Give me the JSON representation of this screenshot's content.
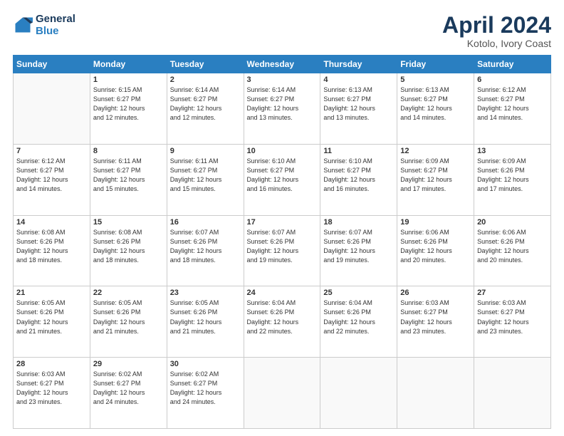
{
  "header": {
    "logo_line1": "General",
    "logo_line2": "Blue",
    "main_title": "April 2024",
    "subtitle": "Kotolo, Ivory Coast"
  },
  "calendar": {
    "days_of_week": [
      "Sunday",
      "Monday",
      "Tuesday",
      "Wednesday",
      "Thursday",
      "Friday",
      "Saturday"
    ],
    "weeks": [
      [
        {
          "day": "",
          "info": ""
        },
        {
          "day": "1",
          "info": "Sunrise: 6:15 AM\nSunset: 6:27 PM\nDaylight: 12 hours\nand 12 minutes."
        },
        {
          "day": "2",
          "info": "Sunrise: 6:14 AM\nSunset: 6:27 PM\nDaylight: 12 hours\nand 12 minutes."
        },
        {
          "day": "3",
          "info": "Sunrise: 6:14 AM\nSunset: 6:27 PM\nDaylight: 12 hours\nand 13 minutes."
        },
        {
          "day": "4",
          "info": "Sunrise: 6:13 AM\nSunset: 6:27 PM\nDaylight: 12 hours\nand 13 minutes."
        },
        {
          "day": "5",
          "info": "Sunrise: 6:13 AM\nSunset: 6:27 PM\nDaylight: 12 hours\nand 14 minutes."
        },
        {
          "day": "6",
          "info": "Sunrise: 6:12 AM\nSunset: 6:27 PM\nDaylight: 12 hours\nand 14 minutes."
        }
      ],
      [
        {
          "day": "7",
          "info": "Sunrise: 6:12 AM\nSunset: 6:27 PM\nDaylight: 12 hours\nand 14 minutes."
        },
        {
          "day": "8",
          "info": "Sunrise: 6:11 AM\nSunset: 6:27 PM\nDaylight: 12 hours\nand 15 minutes."
        },
        {
          "day": "9",
          "info": "Sunrise: 6:11 AM\nSunset: 6:27 PM\nDaylight: 12 hours\nand 15 minutes."
        },
        {
          "day": "10",
          "info": "Sunrise: 6:10 AM\nSunset: 6:27 PM\nDaylight: 12 hours\nand 16 minutes."
        },
        {
          "day": "11",
          "info": "Sunrise: 6:10 AM\nSunset: 6:27 PM\nDaylight: 12 hours\nand 16 minutes."
        },
        {
          "day": "12",
          "info": "Sunrise: 6:09 AM\nSunset: 6:27 PM\nDaylight: 12 hours\nand 17 minutes."
        },
        {
          "day": "13",
          "info": "Sunrise: 6:09 AM\nSunset: 6:26 PM\nDaylight: 12 hours\nand 17 minutes."
        }
      ],
      [
        {
          "day": "14",
          "info": "Sunrise: 6:08 AM\nSunset: 6:26 PM\nDaylight: 12 hours\nand 18 minutes."
        },
        {
          "day": "15",
          "info": "Sunrise: 6:08 AM\nSunset: 6:26 PM\nDaylight: 12 hours\nand 18 minutes."
        },
        {
          "day": "16",
          "info": "Sunrise: 6:07 AM\nSunset: 6:26 PM\nDaylight: 12 hours\nand 18 minutes."
        },
        {
          "day": "17",
          "info": "Sunrise: 6:07 AM\nSunset: 6:26 PM\nDaylight: 12 hours\nand 19 minutes."
        },
        {
          "day": "18",
          "info": "Sunrise: 6:07 AM\nSunset: 6:26 PM\nDaylight: 12 hours\nand 19 minutes."
        },
        {
          "day": "19",
          "info": "Sunrise: 6:06 AM\nSunset: 6:26 PM\nDaylight: 12 hours\nand 20 minutes."
        },
        {
          "day": "20",
          "info": "Sunrise: 6:06 AM\nSunset: 6:26 PM\nDaylight: 12 hours\nand 20 minutes."
        }
      ],
      [
        {
          "day": "21",
          "info": "Sunrise: 6:05 AM\nSunset: 6:26 PM\nDaylight: 12 hours\nand 21 minutes."
        },
        {
          "day": "22",
          "info": "Sunrise: 6:05 AM\nSunset: 6:26 PM\nDaylight: 12 hours\nand 21 minutes."
        },
        {
          "day": "23",
          "info": "Sunrise: 6:05 AM\nSunset: 6:26 PM\nDaylight: 12 hours\nand 21 minutes."
        },
        {
          "day": "24",
          "info": "Sunrise: 6:04 AM\nSunset: 6:26 PM\nDaylight: 12 hours\nand 22 minutes."
        },
        {
          "day": "25",
          "info": "Sunrise: 6:04 AM\nSunset: 6:26 PM\nDaylight: 12 hours\nand 22 minutes."
        },
        {
          "day": "26",
          "info": "Sunrise: 6:03 AM\nSunset: 6:27 PM\nDaylight: 12 hours\nand 23 minutes."
        },
        {
          "day": "27",
          "info": "Sunrise: 6:03 AM\nSunset: 6:27 PM\nDaylight: 12 hours\nand 23 minutes."
        }
      ],
      [
        {
          "day": "28",
          "info": "Sunrise: 6:03 AM\nSunset: 6:27 PM\nDaylight: 12 hours\nand 23 minutes."
        },
        {
          "day": "29",
          "info": "Sunrise: 6:02 AM\nSunset: 6:27 PM\nDaylight: 12 hours\nand 24 minutes."
        },
        {
          "day": "30",
          "info": "Sunrise: 6:02 AM\nSunset: 6:27 PM\nDaylight: 12 hours\nand 24 minutes."
        },
        {
          "day": "",
          "info": ""
        },
        {
          "day": "",
          "info": ""
        },
        {
          "day": "",
          "info": ""
        },
        {
          "day": "",
          "info": ""
        }
      ]
    ]
  }
}
